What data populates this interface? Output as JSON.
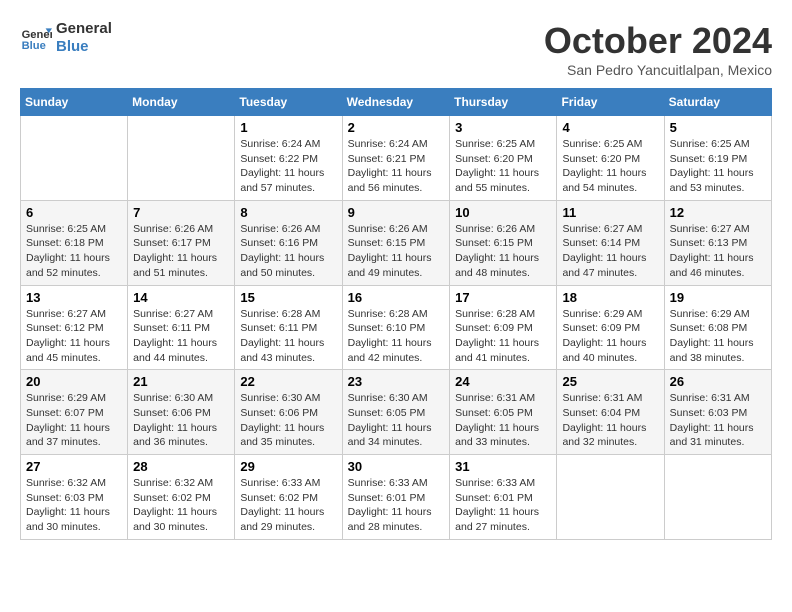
{
  "logo": {
    "line1": "General",
    "line2": "Blue"
  },
  "title": "October 2024",
  "subtitle": "San Pedro Yancuitlalpan, Mexico",
  "days_of_week": [
    "Sunday",
    "Monday",
    "Tuesday",
    "Wednesday",
    "Thursday",
    "Friday",
    "Saturday"
  ],
  "weeks": [
    [
      {
        "day": "",
        "content": ""
      },
      {
        "day": "",
        "content": ""
      },
      {
        "day": "1",
        "content": "Sunrise: 6:24 AM\nSunset: 6:22 PM\nDaylight: 11 hours and 57 minutes."
      },
      {
        "day": "2",
        "content": "Sunrise: 6:24 AM\nSunset: 6:21 PM\nDaylight: 11 hours and 56 minutes."
      },
      {
        "day": "3",
        "content": "Sunrise: 6:25 AM\nSunset: 6:20 PM\nDaylight: 11 hours and 55 minutes."
      },
      {
        "day": "4",
        "content": "Sunrise: 6:25 AM\nSunset: 6:20 PM\nDaylight: 11 hours and 54 minutes."
      },
      {
        "day": "5",
        "content": "Sunrise: 6:25 AM\nSunset: 6:19 PM\nDaylight: 11 hours and 53 minutes."
      }
    ],
    [
      {
        "day": "6",
        "content": "Sunrise: 6:25 AM\nSunset: 6:18 PM\nDaylight: 11 hours and 52 minutes."
      },
      {
        "day": "7",
        "content": "Sunrise: 6:26 AM\nSunset: 6:17 PM\nDaylight: 11 hours and 51 minutes."
      },
      {
        "day": "8",
        "content": "Sunrise: 6:26 AM\nSunset: 6:16 PM\nDaylight: 11 hours and 50 minutes."
      },
      {
        "day": "9",
        "content": "Sunrise: 6:26 AM\nSunset: 6:15 PM\nDaylight: 11 hours and 49 minutes."
      },
      {
        "day": "10",
        "content": "Sunrise: 6:26 AM\nSunset: 6:15 PM\nDaylight: 11 hours and 48 minutes."
      },
      {
        "day": "11",
        "content": "Sunrise: 6:27 AM\nSunset: 6:14 PM\nDaylight: 11 hours and 47 minutes."
      },
      {
        "day": "12",
        "content": "Sunrise: 6:27 AM\nSunset: 6:13 PM\nDaylight: 11 hours and 46 minutes."
      }
    ],
    [
      {
        "day": "13",
        "content": "Sunrise: 6:27 AM\nSunset: 6:12 PM\nDaylight: 11 hours and 45 minutes."
      },
      {
        "day": "14",
        "content": "Sunrise: 6:27 AM\nSunset: 6:11 PM\nDaylight: 11 hours and 44 minutes."
      },
      {
        "day": "15",
        "content": "Sunrise: 6:28 AM\nSunset: 6:11 PM\nDaylight: 11 hours and 43 minutes."
      },
      {
        "day": "16",
        "content": "Sunrise: 6:28 AM\nSunset: 6:10 PM\nDaylight: 11 hours and 42 minutes."
      },
      {
        "day": "17",
        "content": "Sunrise: 6:28 AM\nSunset: 6:09 PM\nDaylight: 11 hours and 41 minutes."
      },
      {
        "day": "18",
        "content": "Sunrise: 6:29 AM\nSunset: 6:09 PM\nDaylight: 11 hours and 40 minutes."
      },
      {
        "day": "19",
        "content": "Sunrise: 6:29 AM\nSunset: 6:08 PM\nDaylight: 11 hours and 38 minutes."
      }
    ],
    [
      {
        "day": "20",
        "content": "Sunrise: 6:29 AM\nSunset: 6:07 PM\nDaylight: 11 hours and 37 minutes."
      },
      {
        "day": "21",
        "content": "Sunrise: 6:30 AM\nSunset: 6:06 PM\nDaylight: 11 hours and 36 minutes."
      },
      {
        "day": "22",
        "content": "Sunrise: 6:30 AM\nSunset: 6:06 PM\nDaylight: 11 hours and 35 minutes."
      },
      {
        "day": "23",
        "content": "Sunrise: 6:30 AM\nSunset: 6:05 PM\nDaylight: 11 hours and 34 minutes."
      },
      {
        "day": "24",
        "content": "Sunrise: 6:31 AM\nSunset: 6:05 PM\nDaylight: 11 hours and 33 minutes."
      },
      {
        "day": "25",
        "content": "Sunrise: 6:31 AM\nSunset: 6:04 PM\nDaylight: 11 hours and 32 minutes."
      },
      {
        "day": "26",
        "content": "Sunrise: 6:31 AM\nSunset: 6:03 PM\nDaylight: 11 hours and 31 minutes."
      }
    ],
    [
      {
        "day": "27",
        "content": "Sunrise: 6:32 AM\nSunset: 6:03 PM\nDaylight: 11 hours and 30 minutes."
      },
      {
        "day": "28",
        "content": "Sunrise: 6:32 AM\nSunset: 6:02 PM\nDaylight: 11 hours and 30 minutes."
      },
      {
        "day": "29",
        "content": "Sunrise: 6:33 AM\nSunset: 6:02 PM\nDaylight: 11 hours and 29 minutes."
      },
      {
        "day": "30",
        "content": "Sunrise: 6:33 AM\nSunset: 6:01 PM\nDaylight: 11 hours and 28 minutes."
      },
      {
        "day": "31",
        "content": "Sunrise: 6:33 AM\nSunset: 6:01 PM\nDaylight: 11 hours and 27 minutes."
      },
      {
        "day": "",
        "content": ""
      },
      {
        "day": "",
        "content": ""
      }
    ]
  ]
}
